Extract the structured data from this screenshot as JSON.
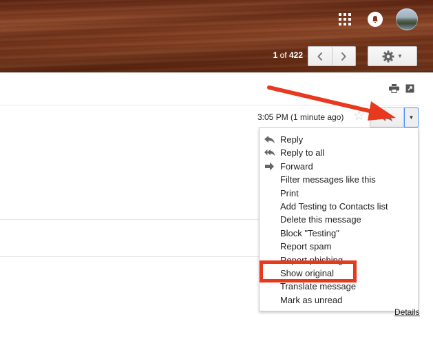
{
  "header": {
    "apps_icon": "apps-grid-icon",
    "notifications_icon": "bell-icon",
    "avatar": "account-avatar",
    "counter": {
      "current": "1",
      "of": "of",
      "total": "422"
    },
    "older_icon": "chevron-left-icon",
    "newer_icon": "chevron-right-icon",
    "settings_icon": "gear-icon"
  },
  "toolbar": {
    "print_icon": "print-icon",
    "popout_icon": "new-window-icon"
  },
  "message": {
    "timestamp": "3:05 PM (1 minute ago)",
    "star_icon": "star-icon",
    "reply_icon": "reply-icon",
    "more_icon": "caret-down-icon"
  },
  "menu": {
    "items": [
      {
        "label": "Reply",
        "icon": "reply-icon"
      },
      {
        "label": "Reply to all",
        "icon": "reply-all-icon"
      },
      {
        "label": "Forward",
        "icon": "forward-icon"
      },
      {
        "label": "Filter messages like this"
      },
      {
        "label": "Print"
      },
      {
        "label": "Add Testing to Contacts list"
      },
      {
        "label": "Delete this message"
      },
      {
        "label": "Block \"Testing\""
      },
      {
        "label": "Report spam"
      },
      {
        "label": "Report phishing"
      },
      {
        "label": "Show original"
      },
      {
        "label": "Translate message"
      },
      {
        "label": "Mark as unread"
      }
    ]
  },
  "footer": {
    "details_link": "Details"
  },
  "annotations": {
    "arrow_color": "#e8391e",
    "highlight_color": "#e8391e"
  },
  "colors": {
    "wood": "#7d3a1e",
    "focus_blue": "#4d90fe"
  }
}
